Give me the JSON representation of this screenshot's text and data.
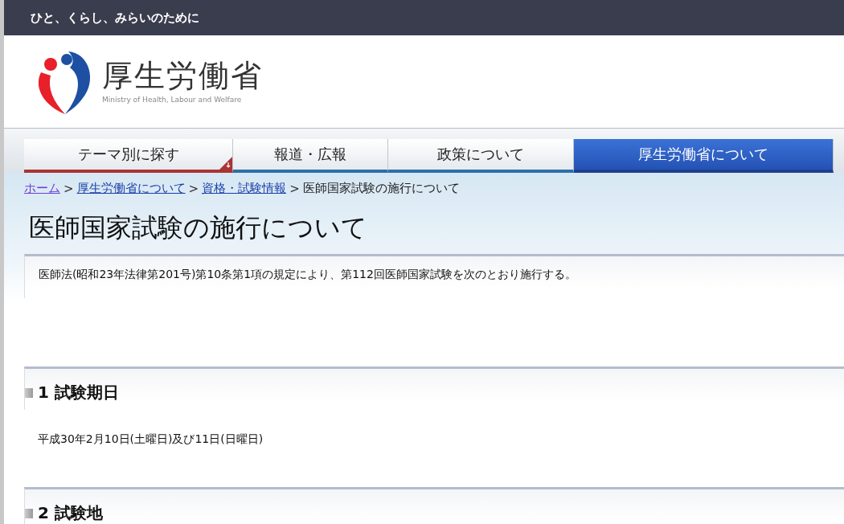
{
  "top_bar": {
    "tagline": "ひと、くらし、みらいのために"
  },
  "header": {
    "logo_title": "厚生労働省",
    "logo_subtitle": "Ministry of Health, Labour and Welfare"
  },
  "nav_tabs": [
    {
      "label": "テーマ別に探す",
      "selected": false,
      "dropdown": true
    },
    {
      "label": "報道・広報",
      "selected": false,
      "dropdown": false
    },
    {
      "label": "政策について",
      "selected": false,
      "dropdown": false
    },
    {
      "label": "厚生労働省について",
      "selected": true,
      "dropdown": false
    }
  ],
  "breadcrumb_separators": [
    ">",
    ">",
    ">"
  ],
  "breadcrumb": [
    {
      "label": "ホーム",
      "link": true,
      "visited": true
    },
    {
      "label": "厚生労働省について",
      "link": true,
      "visited": false
    },
    {
      "label": "資格・試験情報",
      "link": true,
      "visited": false
    },
    {
      "label": "医師国家試験の施行について",
      "link": false,
      "visited": false
    }
  ],
  "page_title": "医師国家試験の施行について",
  "intro": "医師法(昭和23年法律第201号)第10条第1項の規定により、第112回医師国家試験を次のとおり施行する。",
  "sections": [
    {
      "heading": "1 試験期日",
      "body": "平成30年2月10日(土曜日)及び11日(日曜日)"
    },
    {
      "heading": "2 試験地"
    }
  ]
}
